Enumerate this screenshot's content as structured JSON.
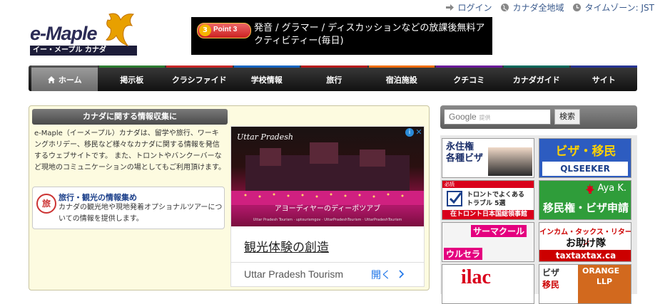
{
  "header": {
    "logo_text": "e-Maple",
    "logo_sub": "イー・メープル カナダ",
    "links": [
      {
        "label": "ログイン",
        "icon": "login-icon"
      },
      {
        "label": "カナダ全地域",
        "icon": "globe-icon"
      },
      {
        "label": "タイムゾーン: JST",
        "icon": "clock-icon"
      }
    ]
  },
  "banner": {
    "badge": "Point 3",
    "coin": "3",
    "text": "発音 / グラマー / ディスカッションなどの放課後無料アクティビティー(毎日)"
  },
  "nav": {
    "items": [
      {
        "label": "ホーム",
        "accent": "#555555"
      },
      {
        "label": "掲示板",
        "accent": "#2e7d32"
      },
      {
        "label": "クラシファイド",
        "accent": "#c62828"
      },
      {
        "label": "学校情報",
        "accent": "#1565c0"
      },
      {
        "label": "旅行",
        "accent": "#b71c1c"
      },
      {
        "label": "宿泊施設",
        "accent": "#ef6c00"
      },
      {
        "label": "クチコミ",
        "accent": "#6a1b9a"
      },
      {
        "label": "カナダガイド",
        "accent": "#00695c"
      },
      {
        "label": "サイト",
        "accent": "#283593"
      }
    ]
  },
  "info": {
    "heading": "カナダに関する情報収集に",
    "text": "e-Maple（イーメープル）カナダは、留学や旅行、ワーキングホリデー、移民など様々なカナダに関する情報を発信するウェブサイトです。 また、トロントやバンクーバーなど現地のコミュニケーションの場としてもご利用頂けます。",
    "travel": {
      "icon_char": "旅",
      "title": "旅行・観光の情報集め",
      "desc": "カナダの観光地や現地発着オプショナルツアーについての情報を提供します。"
    }
  },
  "ad": {
    "brand": "Uttar Pradesh",
    "caption": "アヨーディヤーのディーポツアブ",
    "footer": "Uttar Pradesh Tourism · uptourismgov · UttarPradeshTourism · UttarPradeshTourism",
    "headline": "観光体験の創造",
    "advertiser": "Uttar Pradesh Tourism",
    "open_label": "開く",
    "info_char": "i",
    "close_char": "✕"
  },
  "search": {
    "google": "Google",
    "hint": "提供",
    "button": "検索"
  },
  "side_ads": {
    "a1": {
      "line1": "永住権",
      "line2": "各種ビザ"
    },
    "a2": {
      "title": "ビザ・移民",
      "brand": "QLSEEKER"
    },
    "a3": {
      "ribbon": "必読",
      "line1": "トロントでよくある",
      "line2": "トラブル 5選",
      "bottom": "在トロント日本国総領事館"
    },
    "a4": {
      "name": "Aya K.",
      "title": "移民権・ビザ申請"
    },
    "a5": {
      "top": "サーマクール",
      "bottom": "ウルセラ"
    },
    "a6": {
      "top": "インカム・タックス・リターン",
      "middle": "お助け隊",
      "bottom": "taxtaxtax.ca"
    },
    "a7": {
      "title": "ilac"
    },
    "a8": {
      "left1": "ビザ",
      "left2": "移民",
      "right1": "ORANGE",
      "right2": "LLP"
    }
  },
  "colors": {
    "nav_bg": "#111111",
    "info_bg": "#fdfbe0",
    "link": "#3a5a8c"
  }
}
